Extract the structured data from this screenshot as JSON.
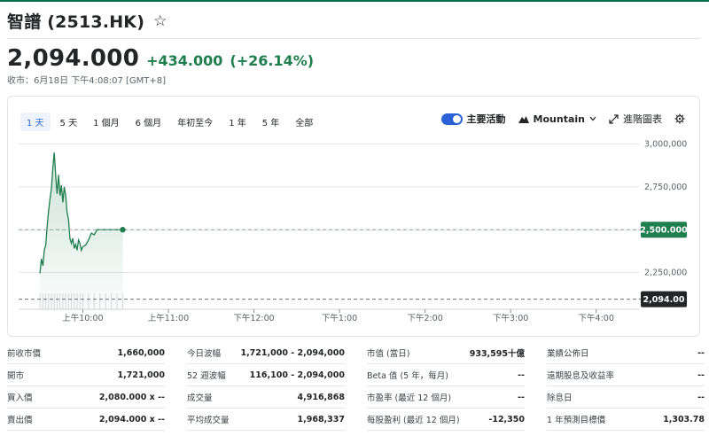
{
  "header": {
    "title": "智譜 (2513.HK)",
    "star_icon": "star-outline-icon"
  },
  "quote": {
    "price": "2,094.000",
    "change": "+434.000",
    "change_pct": "(+26.14%)",
    "closing_note": "收市：6月18日 下午4:08:07 [GMT+8]",
    "up_color": "#1e7e4d"
  },
  "chart_controls": {
    "ranges": [
      "1 天",
      "5 天",
      "1 個月",
      "6 個月",
      "年初至今",
      "1 年",
      "5 年",
      "全部"
    ],
    "active_range": "1 天",
    "key_events_label": "主要活動",
    "chart_type_label": "Mountain",
    "advanced_label": "進階圖表"
  },
  "chart_data": {
    "type": "area",
    "x_ticks": [
      "上午10:00",
      "上午11:00",
      "下午12:00",
      "下午1:00",
      "下午2:00",
      "下午3:00",
      "下午4:00"
    ],
    "y_ticks": [
      "3,000,000",
      "2,750,000",
      "2,500,000",
      "2,250,000"
    ],
    "y_tick_values": [
      3000000,
      2750000,
      2500000,
      2250000
    ],
    "ylim": [
      2035000,
      3050000
    ],
    "session_start_minutes": 555,
    "session_end_minutes": 990,
    "series": [
      {
        "minutes": [
          570,
          571,
          572,
          573,
          574,
          575,
          576,
          577,
          578,
          579,
          580,
          581,
          582,
          583,
          584,
          585,
          586,
          587,
          588,
          589,
          590,
          591,
          592,
          593,
          594,
          595,
          596,
          597,
          598,
          599,
          600,
          602,
          604,
          606,
          608,
          610,
          612,
          614,
          616,
          618,
          620,
          622,
          624,
          626,
          628
        ],
        "values": [
          2245000,
          2330000,
          2290000,
          2380000,
          2410000,
          2520000,
          2610000,
          2680000,
          2740000,
          2860000,
          2950000,
          2820000,
          2710000,
          2820000,
          2700000,
          2760000,
          2660000,
          2750000,
          2700000,
          2600000,
          2560000,
          2450000,
          2420000,
          2450000,
          2390000,
          2415000,
          2380000,
          2440000,
          2420000,
          2380000,
          2400000,
          2410000,
          2440000,
          2480000,
          2470000,
          2500000,
          2500000,
          2500000,
          2500000,
          2500000,
          2500000,
          2500000,
          2500000,
          2500000,
          2500000
        ]
      }
    ],
    "reference_lines": [
      {
        "value": 2500000,
        "label": "2,500.000",
        "color": "#1e7e4d"
      },
      {
        "value": 2094000,
        "label": "2,094.00",
        "color": "#232526"
      }
    ],
    "line_color": "#1e7e4d",
    "grid": true
  },
  "stats": [
    [
      {
        "label": "前收市價",
        "value": "1,660,000"
      },
      {
        "label": "開市",
        "value": "1,721,000"
      },
      {
        "label": "買入價",
        "value": "2,080.000 x --"
      },
      {
        "label": "賣出價",
        "value": "2,094.000 x --"
      }
    ],
    [
      {
        "label": "今日波幅",
        "value": "1,721,000 - 2,094,000"
      },
      {
        "label": "52 週波幅",
        "value": "116,100 - 2,094,000"
      },
      {
        "label": "成交量",
        "value": "4,916,868"
      },
      {
        "label": "平均成交量",
        "value": "1,968,337"
      }
    ],
    [
      {
        "label": "市值 (當日)",
        "value": "933,595十億"
      },
      {
        "label": "Beta 值 (5 年，每月)",
        "value": "--"
      },
      {
        "label": "市盈率 (最近 12 個月)",
        "value": "--"
      },
      {
        "label": "每股盈利 (最近 12 個月)",
        "value": "-12,350"
      }
    ],
    [
      {
        "label": "業績公佈日",
        "value": "--"
      },
      {
        "label": "遠期股息及收益率",
        "value": "--"
      },
      {
        "label": "除息日",
        "value": "--"
      },
      {
        "label": "1 年預測目標價",
        "value": "1,303.78"
      }
    ]
  ]
}
